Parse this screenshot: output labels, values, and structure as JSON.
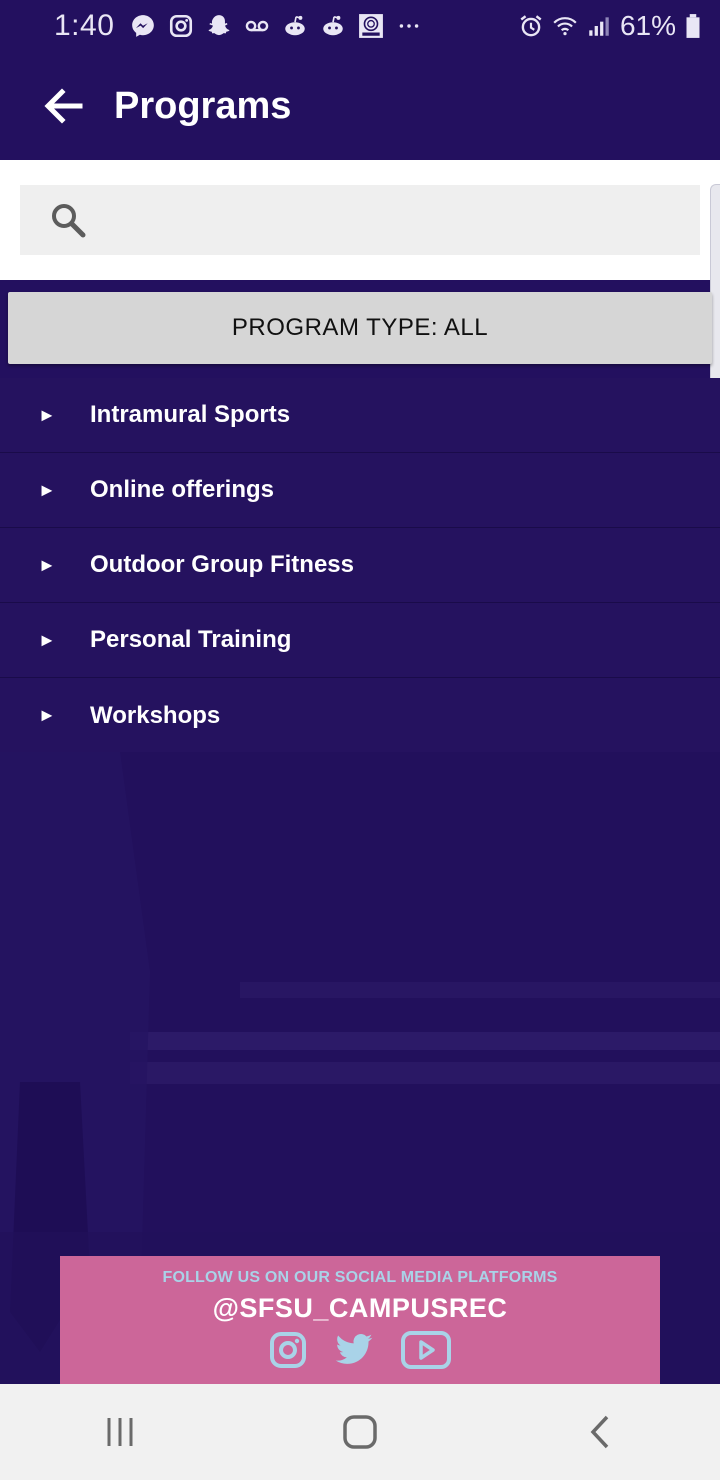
{
  "status_bar": {
    "time": "1:40",
    "battery_percent": "61%",
    "icons_left": [
      "messenger-icon",
      "instagram-icon",
      "snapchat-icon",
      "voicemail-icon",
      "reddit-icon",
      "reddit-icon",
      "sfsu-icon",
      "more-dots-icon"
    ],
    "icons_right": [
      "alarm-icon",
      "wifi-icon",
      "signal-icon",
      "battery-icon"
    ]
  },
  "app_bar": {
    "title": "Programs"
  },
  "search": {
    "placeholder": ""
  },
  "filter": {
    "label": "PROGRAM TYPE: ALL"
  },
  "programs": [
    {
      "label": "Intramural Sports"
    },
    {
      "label": "Online offerings"
    },
    {
      "label": "Outdoor Group Fitness"
    },
    {
      "label": "Personal Training"
    },
    {
      "label": "Workshops"
    }
  ],
  "social_banner": {
    "follow_text": "FOLLOW US ON OUR SOCIAL MEDIA PLATFORMS",
    "handle": "@SFSU_CAMPUSREC",
    "icons": [
      "instagram-icon",
      "twitter-icon",
      "youtube-icon"
    ]
  },
  "nav_bar": {
    "buttons": [
      "recents-button",
      "home-button",
      "back-button"
    ]
  },
  "colors": {
    "primary": "#23105f",
    "banner": "#cc6699",
    "banner_text": "#a9d3e8",
    "filter_bg": "#d6d6d6"
  }
}
